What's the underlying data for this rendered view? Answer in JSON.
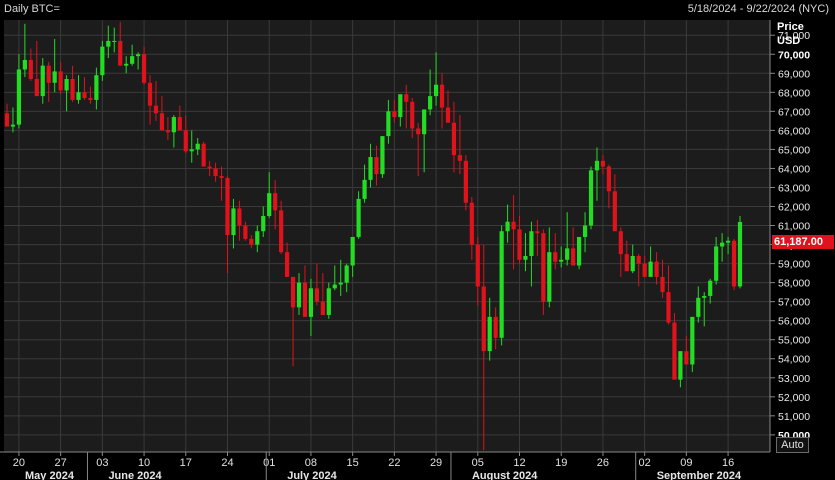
{
  "header": {
    "title": "Daily BTC=",
    "date_range": "5/18/2024 - 9/22/2024 (NYC)"
  },
  "axis": {
    "price_label": "Price",
    "currency_label": "USD",
    "auto_button": "Auto",
    "last_price_label": "61,187.00"
  },
  "colors": {
    "up": "#22dd22",
    "down": "#e0121b",
    "background": "#000000",
    "plot": "#1c1c1c",
    "grid": "#3a3a3a"
  },
  "chart_data": {
    "type": "candlestick",
    "ylim": [
      49100,
      71800
    ],
    "yticks": [
      {
        "value": 50000,
        "label": "50,000",
        "major": true
      },
      {
        "value": 51000,
        "label": "51,000",
        "major": false
      },
      {
        "value": 52000,
        "label": "52,000",
        "major": false
      },
      {
        "value": 53000,
        "label": "53,000",
        "major": false
      },
      {
        "value": 54000,
        "label": "54,000",
        "major": false
      },
      {
        "value": 55000,
        "label": "55,000",
        "major": false
      },
      {
        "value": 56000,
        "label": "56,000",
        "major": false
      },
      {
        "value": 57000,
        "label": "57,000",
        "major": false
      },
      {
        "value": 58000,
        "label": "58,000",
        "major": false
      },
      {
        "value": 59000,
        "label": "59,000",
        "major": false
      },
      {
        "value": 60000,
        "label": "60,000",
        "major": true
      },
      {
        "value": 61000,
        "label": "61,000",
        "major": false
      },
      {
        "value": 62000,
        "label": "62,000",
        "major": false
      },
      {
        "value": 63000,
        "label": "63,000",
        "major": false
      },
      {
        "value": 64000,
        "label": "64,000",
        "major": false
      },
      {
        "value": 65000,
        "label": "65,000",
        "major": false
      },
      {
        "value": 66000,
        "label": "66,000",
        "major": false
      },
      {
        "value": 67000,
        "label": "67,000",
        "major": false
      },
      {
        "value": 68000,
        "label": "68,000",
        "major": false
      },
      {
        "value": 69000,
        "label": "69,000",
        "major": false
      },
      {
        "value": 70000,
        "label": "70,000",
        "major": true
      },
      {
        "value": 71000,
        "label": "71,000",
        "major": false
      }
    ],
    "xticks": [
      {
        "index": 2,
        "label": "20"
      },
      {
        "index": 9,
        "label": "27"
      },
      {
        "index": 16,
        "label": "03"
      },
      {
        "index": 23,
        "label": "10"
      },
      {
        "index": 30,
        "label": "17"
      },
      {
        "index": 37,
        "label": "24"
      },
      {
        "index": 44,
        "label": "01"
      },
      {
        "index": 51,
        "label": "08"
      },
      {
        "index": 58,
        "label": "15"
      },
      {
        "index": 65,
        "label": "22"
      },
      {
        "index": 72,
        "label": "29"
      },
      {
        "index": 79,
        "label": "05"
      },
      {
        "index": 86,
        "label": "12"
      },
      {
        "index": 93,
        "label": "19"
      },
      {
        "index": 100,
        "label": "26"
      },
      {
        "index": 107,
        "label": "02"
      },
      {
        "index": 114,
        "label": "09"
      },
      {
        "index": 121,
        "label": "16"
      }
    ],
    "months": [
      {
        "start_index": 0,
        "label": "May 2024"
      },
      {
        "start_index": 14,
        "label": "June 2024"
      },
      {
        "start_index": 44,
        "label": "July 2024"
      },
      {
        "start_index": 75,
        "label": "August 2024"
      },
      {
        "start_index": 106,
        "label": "September 2024"
      }
    ],
    "candles": [
      [
        66900,
        67400,
        66200,
        66200
      ],
      [
        66200,
        67200,
        65900,
        66300
      ],
      [
        66300,
        70000,
        66100,
        69200
      ],
      [
        69200,
        71600,
        68800,
        69700
      ],
      [
        69700,
        70300,
        68600,
        68700
      ],
      [
        68700,
        70700,
        68500,
        67800
      ],
      [
        67800,
        69800,
        67400,
        69400
      ],
      [
        69400,
        69600,
        67500,
        68500
      ],
      [
        68500,
        70800,
        68000,
        69100
      ],
      [
        69100,
        69600,
        67900,
        68100
      ],
      [
        68100,
        68900,
        67000,
        68700
      ],
      [
        68700,
        69400,
        67500,
        67600
      ],
      [
        67600,
        68900,
        67400,
        68000
      ],
      [
        68000,
        68800,
        67600,
        67700
      ],
      [
        67700,
        68300,
        67400,
        67600
      ],
      [
        67600,
        69300,
        67100,
        68900
      ],
      [
        68900,
        70700,
        68600,
        70400
      ],
      [
        70400,
        71500,
        69800,
        70700
      ],
      [
        70700,
        71400,
        70100,
        70700
      ],
      [
        70700,
        71700,
        69800,
        69400
      ],
      [
        69400,
        69900,
        69000,
        69500
      ],
      [
        69500,
        70500,
        69400,
        69900
      ],
      [
        69900,
        70100,
        69200,
        70000
      ],
      [
        70000,
        70400,
        68400,
        68500
      ],
      [
        68500,
        68900,
        66300,
        67300
      ],
      [
        67300,
        68600,
        66500,
        66900
      ],
      [
        66900,
        67800,
        66000,
        66000
      ],
      [
        66000,
        66700,
        65500,
        65900
      ],
      [
        65900,
        66800,
        65100,
        66700
      ],
      [
        66700,
        67300,
        66000,
        66000
      ],
      [
        66000,
        66800,
        64800,
        64900
      ],
      [
        64900,
        66000,
        64300,
        65000
      ],
      [
        65000,
        65600,
        64700,
        65300
      ],
      [
        65300,
        65400,
        64100,
        64100
      ],
      [
        64100,
        64400,
        63600,
        64000
      ],
      [
        64000,
        64300,
        63300,
        63600
      ],
      [
        63600,
        64100,
        62300,
        63500
      ],
      [
        63500,
        63600,
        58500,
        60500
      ],
      [
        60500,
        62400,
        59800,
        61900
      ],
      [
        61900,
        62300,
        60200,
        61000
      ],
      [
        61000,
        61200,
        60200,
        60300
      ],
      [
        60300,
        60500,
        59800,
        60000
      ],
      [
        60000,
        61000,
        59600,
        60700
      ],
      [
        60700,
        62000,
        60400,
        61500
      ],
      [
        61500,
        63800,
        61400,
        62700
      ],
      [
        62700,
        63400,
        60800,
        61800
      ],
      [
        61800,
        62300,
        59500,
        59600
      ],
      [
        59600,
        60100,
        58300,
        58300
      ],
      [
        58300,
        58300,
        53600,
        56700
      ],
      [
        56700,
        58500,
        56300,
        58000
      ],
      [
        58000,
        58900,
        56200,
        56200
      ],
      [
        56200,
        58200,
        55200,
        57700
      ],
      [
        57700,
        59000,
        56800,
        57000
      ],
      [
        57000,
        58500,
        56700,
        56300
      ],
      [
        56300,
        58000,
        56100,
        57700
      ],
      [
        57700,
        58900,
        57600,
        57900
      ],
      [
        57900,
        59200,
        57300,
        58000
      ],
      [
        58000,
        59000,
        57500,
        58900
      ],
      [
        58900,
        59500,
        58300,
        60400
      ],
      [
        60400,
        62800,
        60300,
        62400
      ],
      [
        62400,
        64200,
        62200,
        63400
      ],
      [
        63400,
        65300,
        63000,
        64600
      ],
      [
        64600,
        65200,
        63100,
        63700
      ],
      [
        63700,
        65200,
        63500,
        65700
      ],
      [
        65700,
        67600,
        65300,
        67000
      ],
      [
        67000,
        67600,
        66400,
        66700
      ],
      [
        66700,
        67300,
        66200,
        67900
      ],
      [
        67900,
        68400,
        66100,
        67500
      ],
      [
        67500,
        67700,
        65600,
        66100
      ],
      [
        66100,
        66400,
        63600,
        65800
      ],
      [
        65800,
        66400,
        63800,
        67100
      ],
      [
        67100,
        69200,
        66800,
        67800
      ],
      [
        67800,
        70100,
        67300,
        68400
      ],
      [
        68400,
        69000,
        66100,
        67200
      ],
      [
        67200,
        68100,
        66600,
        66400
      ],
      [
        66400,
        67500,
        63800,
        64700
      ],
      [
        64700,
        66800,
        63700,
        64400
      ],
      [
        64400,
        64700,
        61800,
        62200
      ],
      [
        62200,
        62500,
        59200,
        60000
      ],
      [
        60000,
        60400,
        56800,
        57800
      ],
      [
        57800,
        60000,
        49200,
        54400
      ],
      [
        54400,
        57200,
        53900,
        56200
      ],
      [
        56200,
        56700,
        54500,
        55100
      ],
      [
        55100,
        61000,
        54700,
        60700
      ],
      [
        60700,
        62100,
        60100,
        61200
      ],
      [
        61200,
        62600,
        58700,
        60800
      ],
      [
        60800,
        61500,
        59000,
        59200
      ],
      [
        59200,
        60600,
        58600,
        59400
      ],
      [
        59400,
        61200,
        57800,
        60700
      ],
      [
        60700,
        61300,
        59400,
        60600
      ],
      [
        60600,
        60800,
        56300,
        57000
      ],
      [
        57000,
        60900,
        56700,
        59600
      ],
      [
        59600,
        60600,
        58700,
        59100
      ],
      [
        59100,
        59900,
        58800,
        59200
      ],
      [
        59200,
        61700,
        58900,
        59800
      ],
      [
        59800,
        60900,
        59200,
        58900
      ],
      [
        58900,
        59900,
        58700,
        60400
      ],
      [
        60400,
        61700,
        59600,
        61000
      ],
      [
        61000,
        64100,
        60800,
        63900
      ],
      [
        63900,
        65100,
        62300,
        64400
      ],
      [
        64400,
        64700,
        63700,
        64100
      ],
      [
        64100,
        64200,
        61900,
        62800
      ],
      [
        62800,
        63700,
        60700,
        60700
      ],
      [
        60700,
        60900,
        58300,
        59500
      ],
      [
        59500,
        60200,
        58700,
        58600
      ],
      [
        58600,
        60000,
        58500,
        59400
      ],
      [
        59400,
        59500,
        57800,
        59000
      ],
      [
        59000,
        59400,
        58700,
        58300
      ],
      [
        58300,
        59900,
        58400,
        59100
      ],
      [
        59100,
        59600,
        57900,
        58300
      ],
      [
        58300,
        59200,
        57200,
        57500
      ],
      [
        57500,
        58900,
        55800,
        55900
      ],
      [
        55900,
        56400,
        54200,
        52900
      ],
      [
        52900,
        54100,
        52500,
        54400
      ],
      [
        54400,
        55200,
        53700,
        53700
      ],
      [
        53700,
        56000,
        53300,
        56200
      ],
      [
        56200,
        57800,
        55900,
        57200
      ],
      [
        57200,
        57500,
        55700,
        57300
      ],
      [
        57300,
        58200,
        56900,
        58100
      ],
      [
        58100,
        60400,
        57900,
        59900
      ],
      [
        59900,
        60600,
        59100,
        60100
      ],
      [
        60100,
        60400,
        59500,
        60200
      ],
      [
        60200,
        60300,
        57600,
        57800
      ],
      [
        57800,
        61500,
        57700,
        61187
      ]
    ]
  }
}
